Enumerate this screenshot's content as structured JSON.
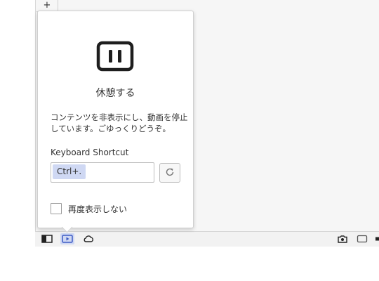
{
  "tabbar": {
    "new_tab_label": "+"
  },
  "popup": {
    "icon": "pause-icon",
    "title": "休憩する",
    "description_lines": [
      "コンテンツを非表示にし、動画を停止",
      "しています。ごゆっくりどうぞ。"
    ],
    "shortcut_label": "Keyboard Shortcut",
    "shortcut_value": "Ctrl+.",
    "reset_icon": "refresh-icon",
    "checkbox_label": "再度表示しない",
    "checkbox_checked": false
  },
  "statusbar": {
    "left_icons": [
      "panel-toggle-icon",
      "pause-icon",
      "cloud-icon"
    ],
    "right_icons": [
      "capture-icon",
      "window-icon",
      "page-tiling-icon"
    ]
  },
  "colors": {
    "accent": "#cfd8f3",
    "icon_dark": "#222222"
  }
}
